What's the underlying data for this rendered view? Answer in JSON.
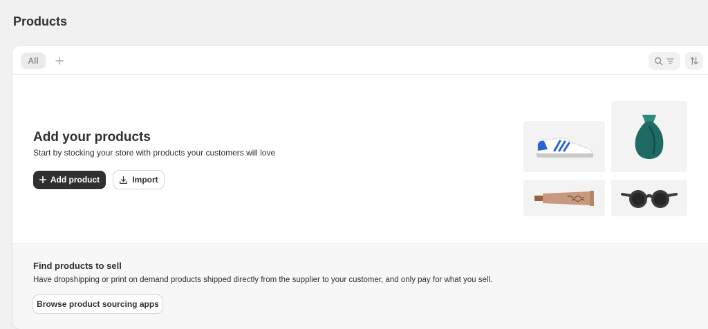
{
  "page": {
    "title": "Products"
  },
  "tabs": {
    "all_label": "All",
    "add_icon": "plus-icon"
  },
  "toolbar": {
    "search_icon": "search-icon",
    "filter_icon": "filter-icon",
    "sort_icon": "sort-icon"
  },
  "empty_state": {
    "title": "Add your products",
    "description": "Start by stocking your store with products your customers will love",
    "add_button_label": "Add product",
    "import_button_label": "Import",
    "illustrations": [
      "sneaker-icon",
      "vase-icon",
      "tube-icon",
      "sunglasses-icon"
    ]
  },
  "sourcing": {
    "title": "Find products to sell",
    "description": "Have dropshipping or print on demand products shipped directly from the supplier to your customer, and only pay for what you sell.",
    "button_label": "Browse product sourcing apps"
  },
  "colors": {
    "primary_button": "#303030",
    "background": "#f1f1f1",
    "vase": "#1f6b63",
    "sneaker_stripe": "#2a63d6",
    "tube": "#c79a80"
  }
}
